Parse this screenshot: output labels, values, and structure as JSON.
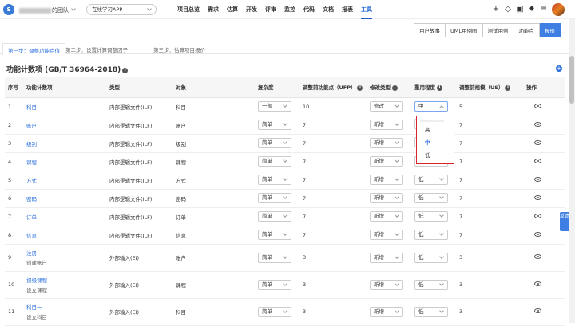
{
  "header": {
    "logo_text": "S",
    "team_suffix": "的团队",
    "project": "在线学习APP",
    "nav": [
      "项目总览",
      "需求",
      "估算",
      "开发",
      "评审",
      "监控",
      "代码",
      "文档",
      "报表",
      "工具"
    ],
    "active_nav": "工具",
    "icons": [
      "plus-icon",
      "layers-icon",
      "briefcase-icon",
      "bell-icon",
      "settings-sliders-icon"
    ]
  },
  "subtabs": [
    "用户故事",
    "UML用例图",
    "测试用例",
    "功能点",
    "报价"
  ],
  "active_subtab": "报价",
  "steps": [
    "第一步：调整功能点值",
    "第二步：设置计算调整因子",
    "第三步：估算项目报价"
  ],
  "section_title": "功能计数项 (GB/T 36964-2018)",
  "columns": [
    "序号",
    "功能计数项",
    "类型",
    "对象",
    "复杂度",
    "调整前功能点（UFP）",
    "修改类型",
    "重用程度",
    "调整前规模（US）",
    "操作"
  ],
  "rows": [
    {
      "no": "1",
      "item": "科目",
      "sub": "",
      "type": "内部逻辑文件(ILF)",
      "obj": "科目",
      "cx": "一般",
      "ufp": "10",
      "mod": "修改",
      "reuse": "中",
      "us": "5"
    },
    {
      "no": "2",
      "item": "账户",
      "sub": "",
      "type": "内部逻辑文件(ILF)",
      "obj": "账户",
      "cx": "简单",
      "ufp": "7",
      "mod": "新增",
      "reuse": "",
      "us": "7"
    },
    {
      "no": "3",
      "item": "级别",
      "sub": "",
      "type": "内部逻辑文件(ILF)",
      "obj": "级别",
      "cx": "简单",
      "ufp": "7",
      "mod": "新增",
      "reuse": "",
      "us": "7"
    },
    {
      "no": "4",
      "item": "课程",
      "sub": "",
      "type": "内部逻辑文件(ILF)",
      "obj": "课程",
      "cx": "简单",
      "ufp": "7",
      "mod": "新增",
      "reuse": "低",
      "us": "7"
    },
    {
      "no": "5",
      "item": "方式",
      "sub": "",
      "type": "内部逻辑文件(ILF)",
      "obj": "方式",
      "cx": "简单",
      "ufp": "7",
      "mod": "新增",
      "reuse": "低",
      "us": "7"
    },
    {
      "no": "6",
      "item": "密码",
      "sub": "",
      "type": "内部逻辑文件(ILF)",
      "obj": "密码",
      "cx": "简单",
      "ufp": "7",
      "mod": "新增",
      "reuse": "低",
      "us": "7"
    },
    {
      "no": "7",
      "item": "订单",
      "sub": "",
      "type": "内部逻辑文件(ILF)",
      "obj": "订单",
      "cx": "简单",
      "ufp": "7",
      "mod": "新增",
      "reuse": "低",
      "us": "7"
    },
    {
      "no": "8",
      "item": "信息",
      "sub": "",
      "type": "内部逻辑文件(ILF)",
      "obj": "信息",
      "cx": "简单",
      "ufp": "7",
      "mod": "新增",
      "reuse": "低",
      "us": "7"
    },
    {
      "no": "9",
      "item": "注册",
      "sub": "创建账户",
      "type": "外部输入(EI)",
      "obj": "账户",
      "cx": "简单",
      "ufp": "3",
      "mod": "新增",
      "reuse": "低",
      "us": "3"
    },
    {
      "no": "10",
      "item": "初级课程",
      "sub": "设立课程",
      "type": "外部输入(EI)",
      "obj": "课程",
      "cx": "简单",
      "ufp": "3",
      "mod": "新增",
      "reuse": "低",
      "us": "3"
    },
    {
      "no": "11",
      "item": "科目一",
      "sub": "设立科目",
      "type": "外部输入(EI)",
      "obj": "科目",
      "cx": "简单",
      "ufp": "3",
      "mod": "新增",
      "reuse": "低",
      "us": "3"
    }
  ],
  "dropdown_options": [
    "高",
    "中",
    "低"
  ],
  "dropdown_selected": "中",
  "feedback": "反馈"
}
